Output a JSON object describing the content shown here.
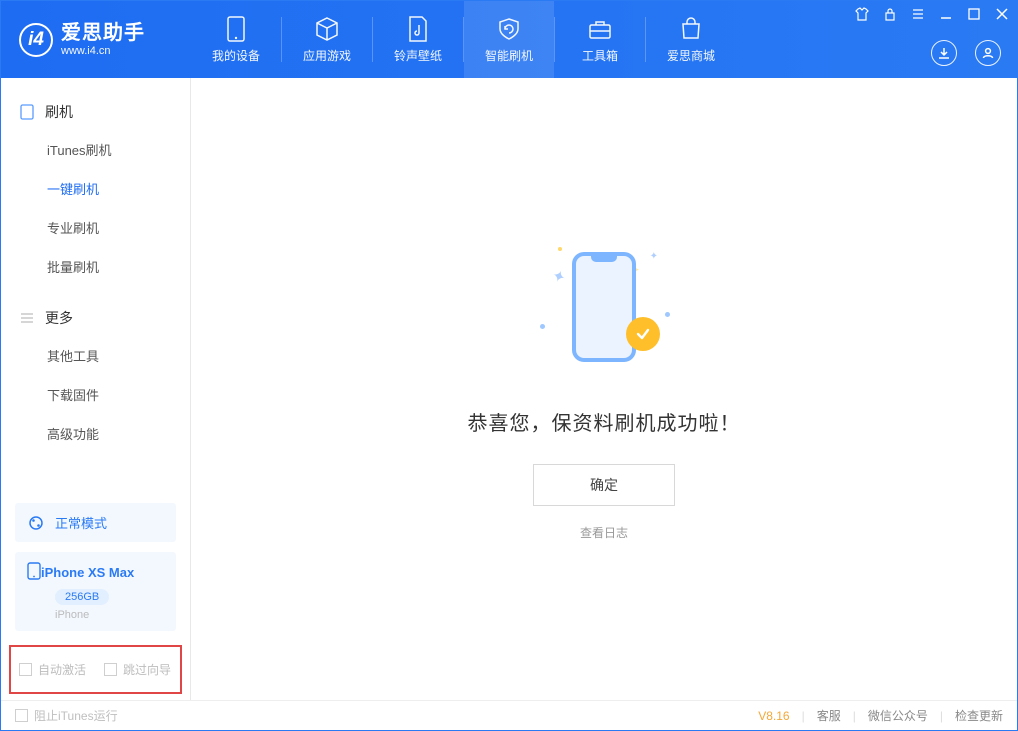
{
  "app": {
    "title": "爱思助手",
    "subtitle": "www.i4.cn"
  },
  "nav": {
    "tabs": [
      {
        "label": "我的设备"
      },
      {
        "label": "应用游戏"
      },
      {
        "label": "铃声壁纸"
      },
      {
        "label": "智能刷机"
      },
      {
        "label": "工具箱"
      },
      {
        "label": "爱思商城"
      }
    ]
  },
  "sidebar": {
    "group1": {
      "title": "刷机",
      "items": [
        {
          "label": "iTunes刷机"
        },
        {
          "label": "一键刷机"
        },
        {
          "label": "专业刷机"
        },
        {
          "label": "批量刷机"
        }
      ]
    },
    "group2": {
      "title": "更多",
      "items": [
        {
          "label": "其他工具"
        },
        {
          "label": "下载固件"
        },
        {
          "label": "高级功能"
        }
      ]
    },
    "mode_card": "正常模式",
    "device": {
      "name": "iPhone XS Max",
      "capacity": "256GB",
      "type": "iPhone"
    },
    "opts": {
      "auto_activate": "自动激活",
      "skip_guide": "跳过向导"
    }
  },
  "main": {
    "success_text": "恭喜您，保资料刷机成功啦！",
    "ok_btn": "确定",
    "view_log": "查看日志"
  },
  "statusbar": {
    "block_itunes": "阻止iTunes运行",
    "version": "V8.16",
    "support": "客服",
    "wechat": "微信公众号",
    "check_update": "检查更新"
  }
}
